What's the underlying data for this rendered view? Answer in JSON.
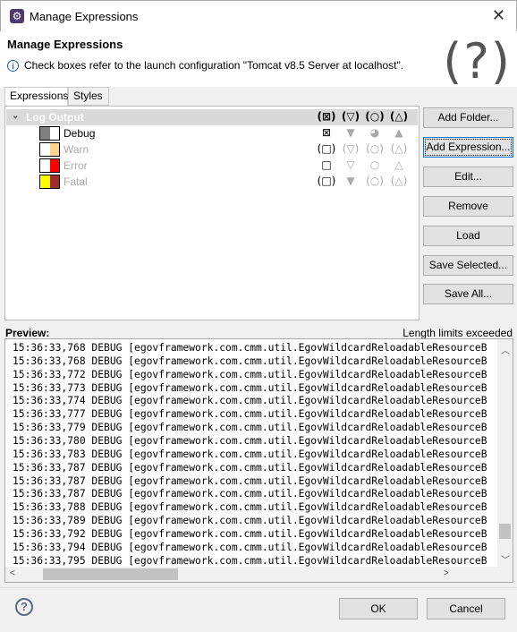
{
  "window": {
    "title": "Manage Expressions",
    "close_icon": "close-icon"
  },
  "header": {
    "title": "Manage Expressions",
    "message": "Check boxes refer to the launch configuration \"Tomcat v8.5 Server at localhost\".",
    "help_glyph": "(?)"
  },
  "tabs": [
    {
      "label": "Expressions",
      "active": true
    },
    {
      "label": "Styles",
      "active": false
    }
  ],
  "tree": {
    "folder": {
      "label": "Log Output",
      "cols": [
        "(⊠)",
        "(▽)",
        "(○)",
        "(△)"
      ]
    },
    "items": [
      {
        "label": "Debug",
        "enabled": true,
        "colors": [
          "#808080",
          "#ffffff"
        ],
        "cols": [
          "⊠",
          "▼",
          "◕",
          "▲"
        ]
      },
      {
        "label": "Warn",
        "enabled": false,
        "colors": [
          "#ffffff",
          "#ffd38a"
        ],
        "cols": [
          "(□)",
          "(▽)",
          "(○)",
          "(△)"
        ]
      },
      {
        "label": "Error",
        "enabled": false,
        "colors": [
          "#ffffff",
          "#ff0000"
        ],
        "cols": [
          "□",
          "▽",
          "○",
          "△"
        ]
      },
      {
        "label": "Fatal",
        "enabled": false,
        "colors": [
          "#ffff00",
          "#a52a2a"
        ],
        "cols": [
          "(□)",
          "▼",
          "(○)",
          "(△)"
        ]
      }
    ]
  },
  "buttons": [
    "Add Folder...",
    "Add Expression...",
    "Edit...",
    "Remove",
    "Load",
    "Save Selected...",
    "Save All..."
  ],
  "preview": {
    "label": "Preview:",
    "status": "Length limits exceeded",
    "lines": [
      "15:36:33,768 DEBUG [egovframework.com.cmm.util.EgovWildcardReloadableResourceB",
      "15:36:33,768 DEBUG [egovframework.com.cmm.util.EgovWildcardReloadableResourceB",
      "15:36:33,772 DEBUG [egovframework.com.cmm.util.EgovWildcardReloadableResourceB",
      "15:36:33,773 DEBUG [egovframework.com.cmm.util.EgovWildcardReloadableResourceB",
      "15:36:33,774 DEBUG [egovframework.com.cmm.util.EgovWildcardReloadableResourceB",
      "15:36:33,777 DEBUG [egovframework.com.cmm.util.EgovWildcardReloadableResourceB",
      "15:36:33,779 DEBUG [egovframework.com.cmm.util.EgovWildcardReloadableResourceB",
      "15:36:33,780 DEBUG [egovframework.com.cmm.util.EgovWildcardReloadableResourceB",
      "15:36:33,783 DEBUG [egovframework.com.cmm.util.EgovWildcardReloadableResourceB",
      "15:36:33,787 DEBUG [egovframework.com.cmm.util.EgovWildcardReloadableResourceB",
      "15:36:33,787 DEBUG [egovframework.com.cmm.util.EgovWildcardReloadableResourceB",
      "15:36:33,787 DEBUG [egovframework.com.cmm.util.EgovWildcardReloadableResourceB",
      "15:36:33,788 DEBUG [egovframework.com.cmm.util.EgovWildcardReloadableResourceB",
      "15:36:33,789 DEBUG [egovframework.com.cmm.util.EgovWildcardReloadableResourceB",
      "15:36:33,792 DEBUG [egovframework.com.cmm.util.EgovWildcardReloadableResourceB",
      "15:36:33,794 DEBUG [egovframework.com.cmm.util.EgovWildcardReloadableResourceB",
      "15:36:33,795 DEBUG [egovframework.com.cmm.util.EgovWildcardReloadableResourceB"
    ]
  },
  "footer": {
    "ok": "OK",
    "cancel": "Cancel"
  }
}
